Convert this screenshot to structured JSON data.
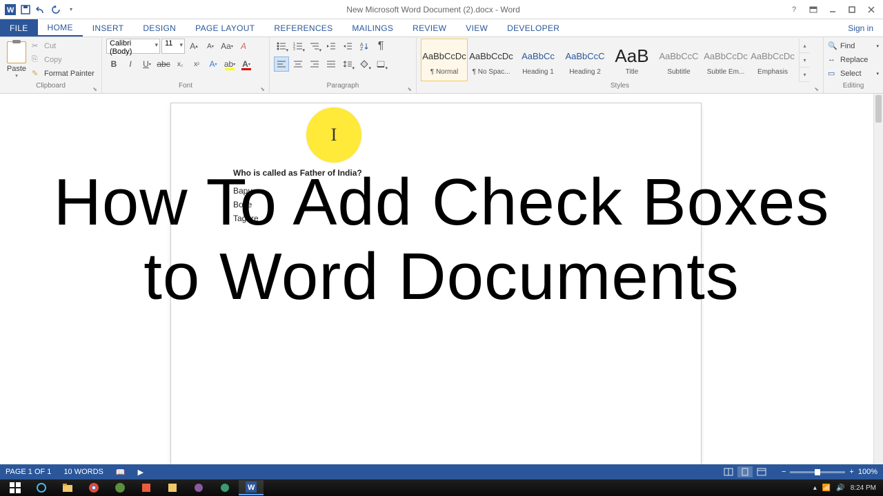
{
  "title": "New Microsoft Word Document (2).docx - Word",
  "signin": "Sign in",
  "tabs": [
    "FILE",
    "HOME",
    "INSERT",
    "DESIGN",
    "PAGE LAYOUT",
    "REFERENCES",
    "MAILINGS",
    "REVIEW",
    "VIEW",
    "DEVELOPER"
  ],
  "active_tab": 1,
  "clipboard": {
    "paste": "Paste",
    "cut": "Cut",
    "copy": "Copy",
    "format_painter": "Format Painter",
    "label": "Clipboard"
  },
  "font": {
    "name": "Calibri (Body)",
    "size": "11",
    "label": "Font"
  },
  "paragraph": {
    "label": "Paragraph"
  },
  "styles": {
    "label": "Styles",
    "items": [
      {
        "preview": "AaBbCcDc",
        "name": "¶ Normal",
        "cls": ""
      },
      {
        "preview": "AaBbCcDc",
        "name": "¶ No Spac...",
        "cls": ""
      },
      {
        "preview": "AaBbCc",
        "name": "Heading 1",
        "cls": "blue"
      },
      {
        "preview": "AaBbCcC",
        "name": "Heading 2",
        "cls": "blue"
      },
      {
        "preview": "AaB",
        "name": "Title",
        "cls": "big"
      },
      {
        "preview": "AaBbCcC",
        "name": "Subtitle",
        "cls": "gray"
      },
      {
        "preview": "AaBbCcDc",
        "name": "Subtle Em...",
        "cls": "gray"
      },
      {
        "preview": "AaBbCcDc",
        "name": "Emphasis",
        "cls": "gray"
      }
    ]
  },
  "editing": {
    "find": "Find",
    "replace": "Replace",
    "select": "Select",
    "label": "Editing"
  },
  "document": {
    "question": "Who is called as Father of India?",
    "answers": [
      "Bapu",
      "Bose",
      "Tagore"
    ]
  },
  "overlay": {
    "line1": "How To Add Check Boxes",
    "line2": "to Word Documents"
  },
  "status": {
    "page": "PAGE 1 OF 1",
    "words": "10 WORDS",
    "zoom": "100%",
    "time": "8:24 PM"
  }
}
